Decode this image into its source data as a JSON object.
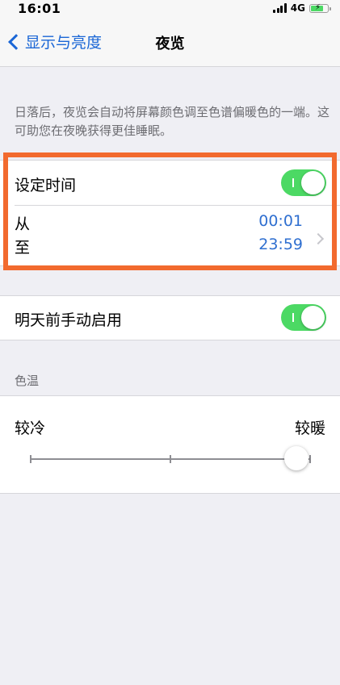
{
  "status_bar": {
    "time": "16:01",
    "network": "4G"
  },
  "nav": {
    "back_label": "显示与亮度",
    "title": "夜览"
  },
  "description": "日落后，夜览会自动将屏幕颜色调至色谱偏暖色的一端。这可助您在夜晚获得更佳睡眠。",
  "schedule": {
    "label": "设定时间",
    "enabled": true,
    "from_label": "从",
    "to_label": "至",
    "from_time": "00:01",
    "to_time": "23:59"
  },
  "manual": {
    "label": "明天前手动启用",
    "enabled": true
  },
  "color_temp": {
    "section_title": "色温",
    "less_label": "较冷",
    "more_label": "较暖",
    "value": 0.95
  },
  "colors": {
    "accent": "#1a66d6",
    "toggle_on": "#4cd964",
    "highlight": "#f26a2e"
  }
}
